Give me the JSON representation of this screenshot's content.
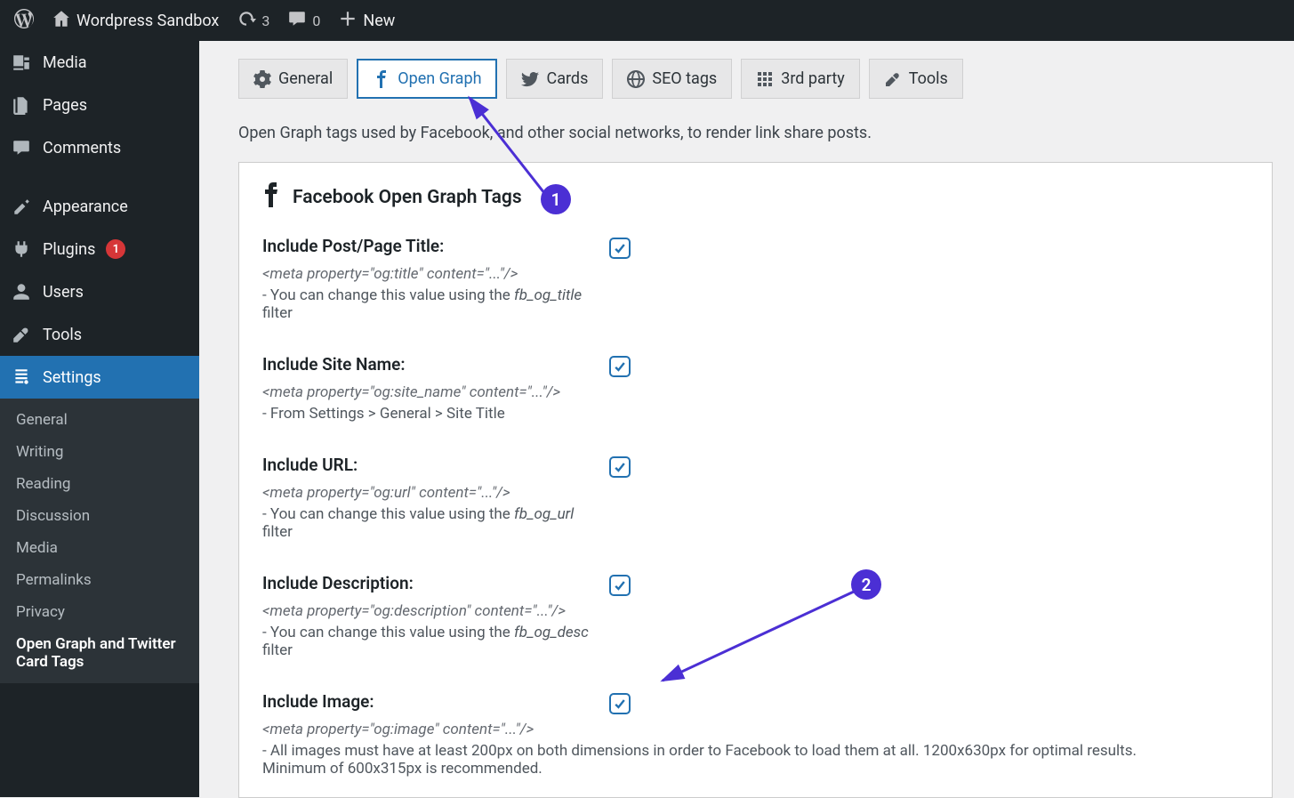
{
  "adminbar": {
    "site_name": "Wordpress Sandbox",
    "updates_count": "3",
    "comments_count": "0",
    "new_label": "New"
  },
  "sidebar": {
    "items": [
      {
        "label": "Media"
      },
      {
        "label": "Pages"
      },
      {
        "label": "Comments"
      },
      {
        "label": "Appearance"
      },
      {
        "label": "Plugins",
        "badge": "1"
      },
      {
        "label": "Users"
      },
      {
        "label": "Tools"
      },
      {
        "label": "Settings"
      }
    ],
    "submenu": [
      {
        "label": "General"
      },
      {
        "label": "Writing"
      },
      {
        "label": "Reading"
      },
      {
        "label": "Discussion"
      },
      {
        "label": "Media"
      },
      {
        "label": "Permalinks"
      },
      {
        "label": "Privacy"
      },
      {
        "label": "Open Graph and Twitter Card Tags"
      }
    ]
  },
  "tabs": {
    "general": "General",
    "open_graph": "Open Graph",
    "cards": "Cards",
    "seo_tags": "SEO tags",
    "third_party": "3rd party",
    "tools": "Tools"
  },
  "intro": "Open Graph tags used by Facebook, and other social networks, to render link share posts.",
  "panel_title": "Facebook Open Graph Tags",
  "fields": {
    "title": {
      "label": "Include Post/Page Title:",
      "meta": "<meta property=\"og:title\" content=\"...\"/>",
      "help_prefix": "- You can change this value using the ",
      "filter": "fb_og_title",
      "help_suffix": " filter"
    },
    "site_name": {
      "label": "Include Site Name:",
      "meta": "<meta property=\"og:site_name\" content=\"...\"/>",
      "help": "- From Settings > General > Site Title"
    },
    "url": {
      "label": "Include URL:",
      "meta": "<meta property=\"og:url\" content=\"...\"/>",
      "help_prefix": "- You can change this value using the ",
      "filter": "fb_og_url",
      "help_suffix": " filter"
    },
    "description": {
      "label": "Include Description:",
      "meta": "<meta property=\"og:description\" content=\"...\"/>",
      "help_prefix": "- You can change this value using the ",
      "filter": "fb_og_desc",
      "help_suffix": " filter"
    },
    "image": {
      "label": "Include Image:",
      "meta": "<meta property=\"og:image\" content=\"...\"/>",
      "help": "- All images must have at least 200px on both dimensions in order to Facebook to load them at all. 1200x630px for optimal results. Minimum of 600x315px is recommended."
    }
  },
  "annotations": {
    "one": "1",
    "two": "2"
  }
}
